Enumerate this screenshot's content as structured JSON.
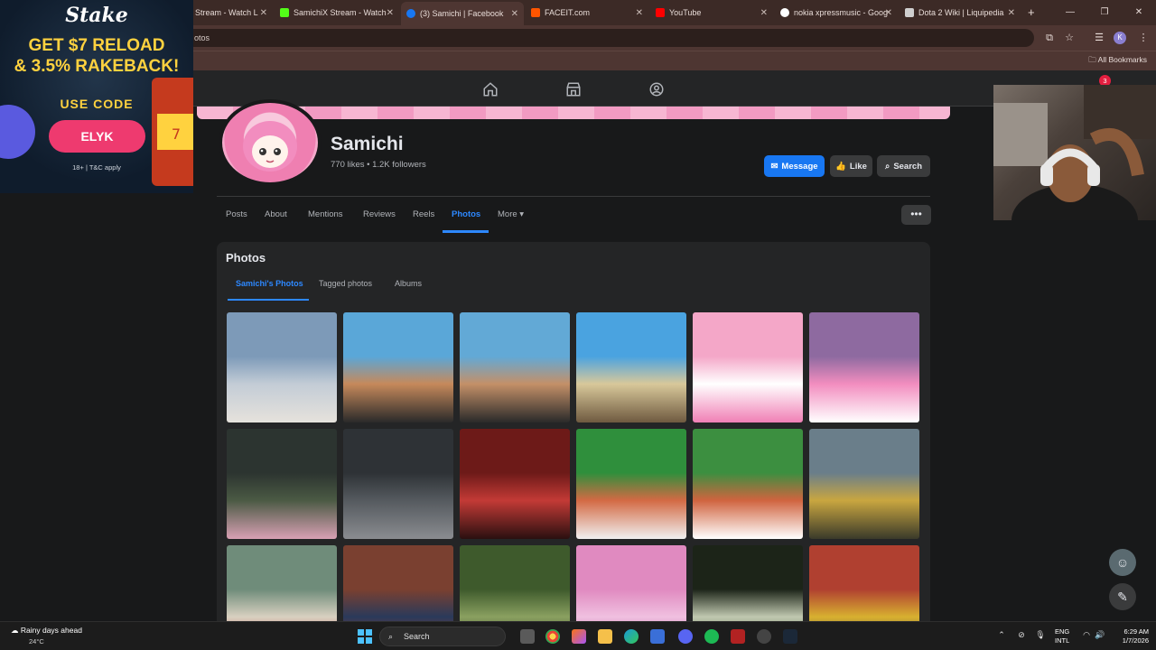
{
  "browser": {
    "tabs": [
      {
        "title": "Stream - Watch L",
        "fav_color": "#9147ff"
      },
      {
        "title": "SamichiX Stream - Watch",
        "fav_color": "#53fc18"
      },
      {
        "title": "(3) Samichi | Facebook",
        "fav_color": "#1877f2"
      },
      {
        "title": "FACEIT.com",
        "fav_color": "#ff5500"
      },
      {
        "title": "YouTube",
        "fav_color": "#ff0000"
      },
      {
        "title": "nokia xpressmusic - Goog",
        "fav_color": "#ffffff"
      },
      {
        "title": "Dota 2 Wiki | Liquipedia",
        "fav_color": "#cfcfcf"
      }
    ],
    "url_fragment": "otos",
    "bookmarks_label": "All Bookmarks",
    "profile_initial": "K"
  },
  "fb_nav": {
    "notification_count": "3"
  },
  "profile": {
    "name": "Samichi",
    "stats": "770 likes • 1.2K followers",
    "message_label": "Message",
    "like_label": "Like",
    "search_label": "Search"
  },
  "profile_tabs": {
    "items": [
      "Posts",
      "About",
      "Mentions",
      "Reviews",
      "Reels",
      "Photos",
      "More"
    ],
    "active": "Photos",
    "more_menu": "•••"
  },
  "photos_section": {
    "title": "Photos",
    "subtabs": [
      "Samichi's Photos",
      "Tagged photos",
      "Albums"
    ],
    "active_subtab": "Samichi's Photos",
    "photos": [
      {
        "desc": "sky-field",
        "colors": [
          "#7d9ab8",
          "#c3ccd6",
          "#e6e2dc"
        ]
      },
      {
        "desc": "group-photo",
        "colors": [
          "#5aa7d8",
          "#c6895b",
          "#2a2a2a"
        ]
      },
      {
        "desc": "group-photo-2",
        "colors": [
          "#62a9d6",
          "#c49068",
          "#2a2a2a"
        ]
      },
      {
        "desc": "car-photo",
        "colors": [
          "#4aa3e0",
          "#d8c89a",
          "#6f5a40"
        ]
      },
      {
        "desc": "pink-banner",
        "colors": [
          "#f4a7c8",
          "#ffffff",
          "#f07fb5"
        ]
      },
      {
        "desc": "pink-avatar",
        "colors": [
          "#8e6aa0",
          "#f28dbf",
          "#ffffff"
        ]
      },
      {
        "desc": "dark-group",
        "colors": [
          "#2c3430",
          "#4b5a44",
          "#d8a0b4"
        ]
      },
      {
        "desc": "dark-group-2",
        "colors": [
          "#2e3236",
          "#555a5f",
          "#8a8c90"
        ]
      },
      {
        "desc": "red-room",
        "colors": [
          "#6d1a18",
          "#c33a36",
          "#2a1010"
        ]
      },
      {
        "desc": "track-pose",
        "colors": [
          "#2f8f3c",
          "#d36a44",
          "#f0f0f0"
        ]
      },
      {
        "desc": "track-sit",
        "colors": [
          "#3c8f40",
          "#d0643f",
          "#ffffff"
        ]
      },
      {
        "desc": "big-group",
        "colors": [
          "#6a7e8a",
          "#c9a640",
          "#3a3a2a"
        ]
      },
      {
        "desc": "room-table",
        "colors": [
          "#6f8c7a",
          "#d8d0c0",
          "#c33a3a"
        ]
      },
      {
        "desc": "garage-group",
        "colors": [
          "#7a4030",
          "#2a3a5a",
          "#c04030"
        ]
      },
      {
        "desc": "garden-pose",
        "colors": [
          "#3e5a2c",
          "#8aa060",
          "#1c2a16"
        ]
      },
      {
        "desc": "princess-peach",
        "colors": [
          "#e08ac0",
          "#f0c0e0",
          "#b04a90"
        ]
      },
      {
        "desc": "dark-portrait",
        "colors": [
          "#1c2418",
          "#c0c8b0",
          "#3a4a2a"
        ]
      },
      {
        "desc": "yellow-group",
        "colors": [
          "#b04030",
          "#d8b030",
          "#3a3a3a"
        ]
      }
    ]
  },
  "ad": {
    "brand": "Stake",
    "line1": "GET $7 RELOAD",
    "line2": "& 3.5% RAKEBACK!",
    "use_code": "USE CODE",
    "code": "ELYK",
    "disclaimer": "18+ | T&C apply"
  },
  "taskbar": {
    "weather_title": "Rainy days ahead",
    "weather_temp": "24°C",
    "search_label": "Search",
    "lang1": "ENG",
    "lang2": "INTL",
    "time": "6:29 AM",
    "date": "1/7/2026"
  }
}
